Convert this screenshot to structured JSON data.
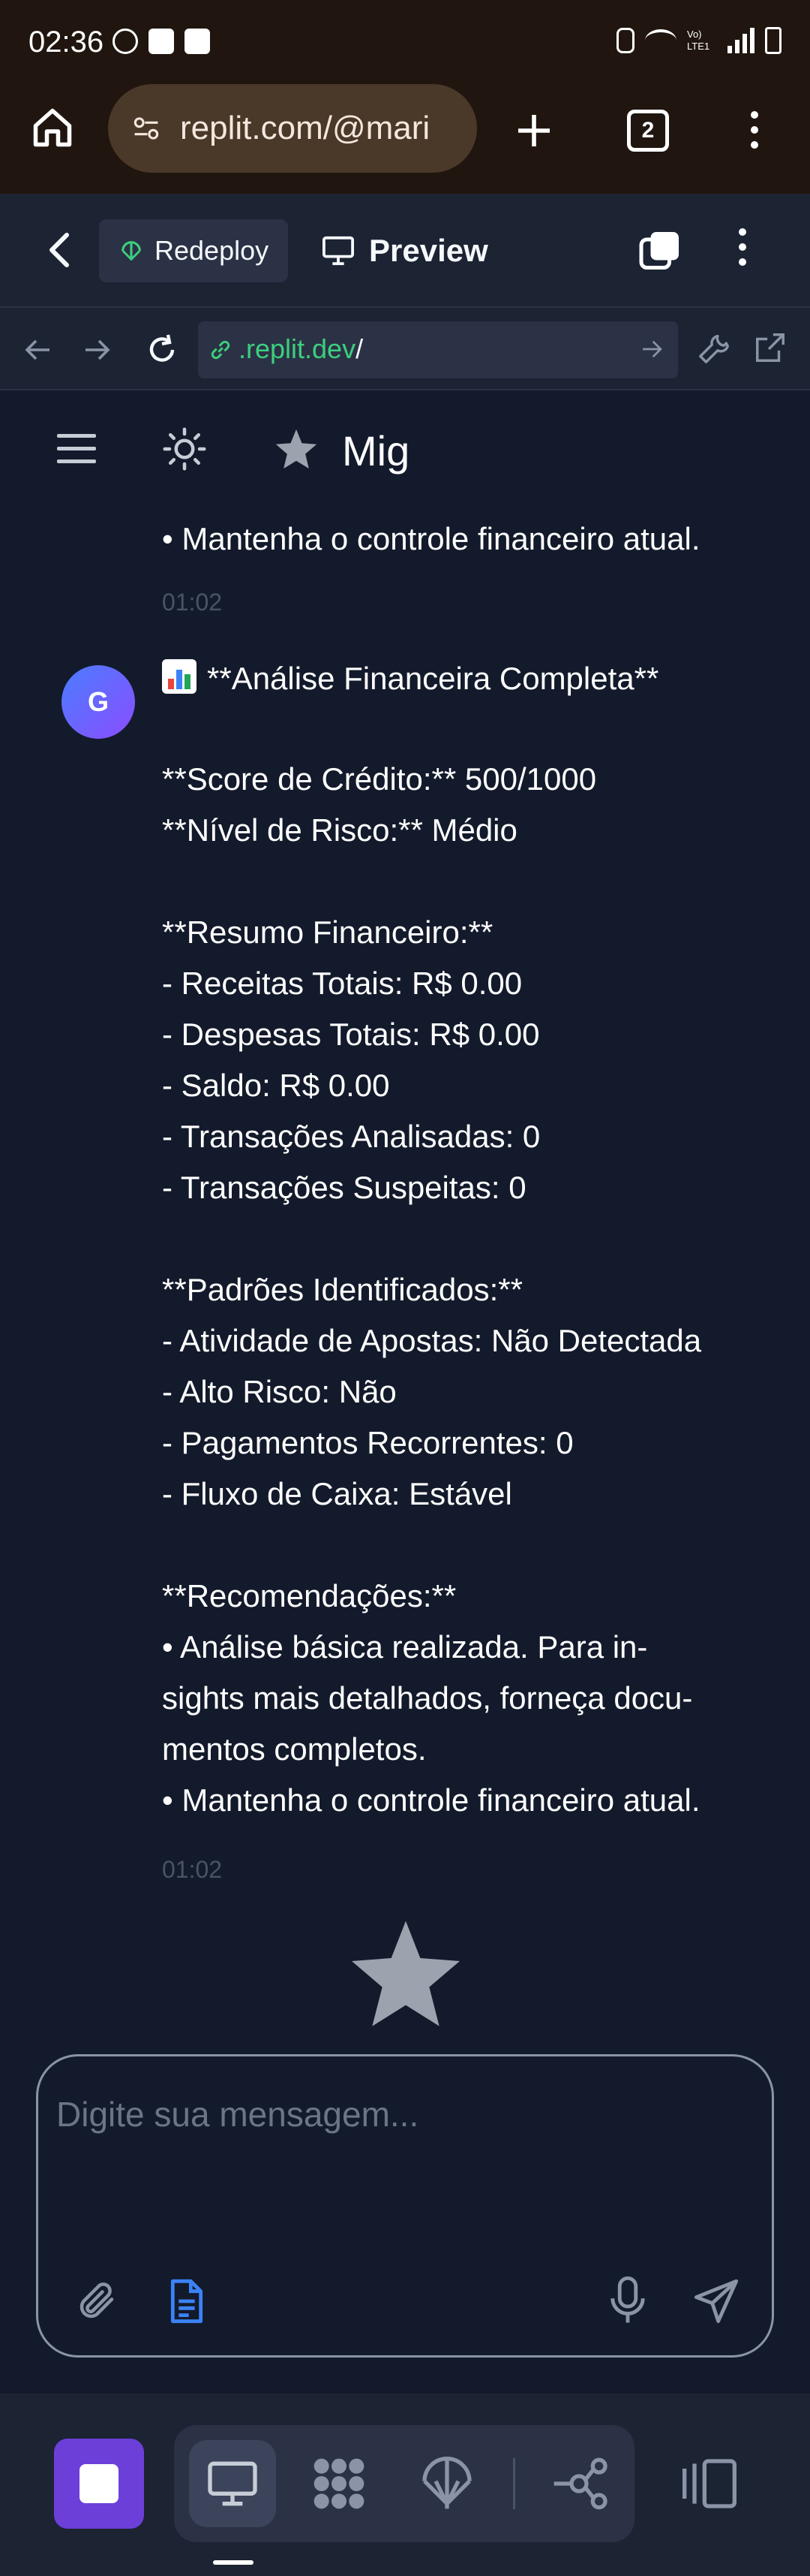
{
  "status_bar": {
    "time": "02:36",
    "lte_label": "Vo) LTE1",
    "icons": [
      "do-not-disturb-icon",
      "check-icon",
      "screen-icon",
      "vibrate-icon",
      "wifi-icon",
      "signal-icon",
      "battery-icon"
    ]
  },
  "browser": {
    "url": "replit.com/@mari",
    "tab_count": "2"
  },
  "replit_header": {
    "redeploy_label": "Redeploy",
    "preview_label": "Preview"
  },
  "address_bar": {
    "url_green": ".replit.dev",
    "url_rest": "/"
  },
  "app_header": {
    "title": "Mig"
  },
  "chat": {
    "prev_message_tail": "• Mantenha o controle financeiro atual.",
    "prev_time": "01:02",
    "message": {
      "avatar": "G",
      "lines": [
        "**Análise Financeira Completa**",
        "**Score de Crédito:** 500/1000",
        "**Nível de Risco:** Médio",
        "",
        "**Resumo Financeiro:**",
        "- Receitas Totais: R$ 0.00",
        "- Despesas Totais: R$ 0.00",
        "- Saldo: R$ 0.00",
        "- Transações Analisadas: 0",
        "- Transações Suspeitas: 0",
        "",
        "**Padrões Identificados:**",
        "- Atividade de Apostas: Não Detectada",
        "- Alto Risco: Não",
        "- Pagamentos Recorrentes: 0",
        "- Fluxo de Caixa: Estável",
        "",
        "**Recomendações:**",
        "• Análise básica realizada. Para in-",
        "sights mais detalhados, forneça docu-",
        "mentos completos.",
        "• Mantenha o controle financeiro atual."
      ],
      "time": "01:02"
    }
  },
  "composer": {
    "placeholder": "Digite sua mensagem..."
  },
  "colors": {
    "background": "#131a2b",
    "panel": "#1c2333",
    "browser_chrome": "#20160f",
    "accent_purple": "#6c3fd9",
    "link_green": "#3ccf7e"
  }
}
